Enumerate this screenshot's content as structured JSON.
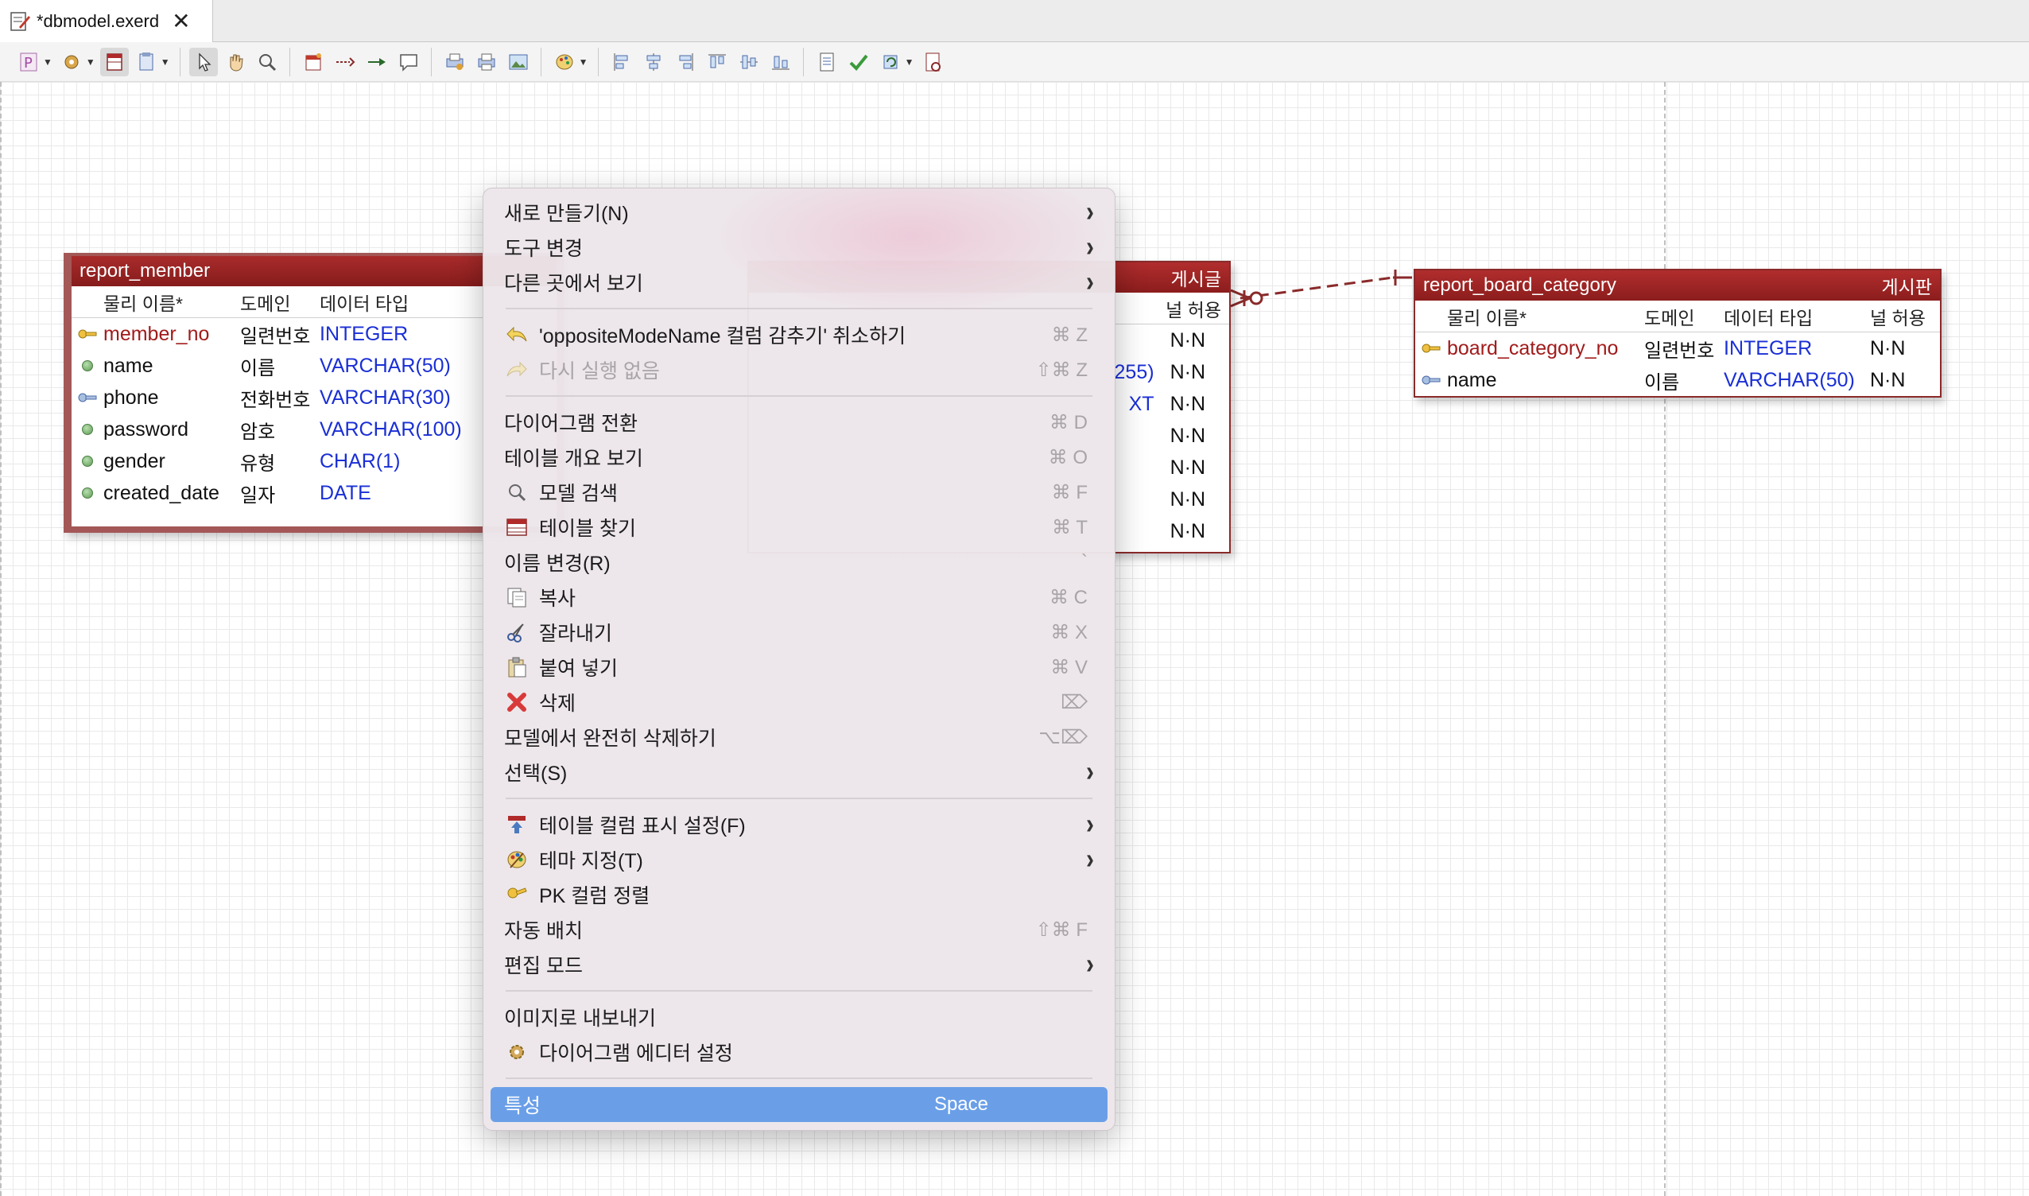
{
  "tab": {
    "title": "*dbmodel.exerd",
    "close": "✕"
  },
  "toolbar": {
    "groups": [
      [
        "schema-icon",
        "object-icon",
        "table-view-icon",
        "page-icon"
      ],
      [
        "select-icon",
        "hand-icon",
        "zoom-icon"
      ],
      [
        "table-icon",
        "relation-icon",
        "relation2-icon",
        "note-icon"
      ],
      [
        "print-setup-icon",
        "print-icon",
        "image-icon"
      ],
      [
        "theme-icon"
      ],
      [
        "align-left-icon",
        "align-center-icon",
        "align-right-icon",
        "align-top-icon",
        "align-middle-icon",
        "align-bottom-icon"
      ],
      [
        "doc-icon",
        "validate-icon",
        "sync-icon",
        "report-icon"
      ]
    ]
  },
  "tables": {
    "member": {
      "name": "report_member",
      "headers": [
        "물리 이름*",
        "도메인",
        "데이터 타입"
      ],
      "rows": [
        {
          "name": "member_no",
          "domain": "일련번호",
          "type": "INTEGER",
          "pk": true
        },
        {
          "name": "name",
          "domain": "이름",
          "type": "VARCHAR(50)"
        },
        {
          "name": "phone",
          "domain": "전화번호",
          "type": "VARCHAR(30)",
          "fk": true
        },
        {
          "name": "password",
          "domain": "암호",
          "type": "VARCHAR(100)"
        },
        {
          "name": "gender",
          "domain": "유형",
          "type": "CHAR(1)"
        },
        {
          "name": "created_date",
          "domain": "일자",
          "type": "DATE"
        }
      ]
    },
    "board": {
      "logical_name": "게시글",
      "null_header": "널 허용",
      "type_fragments": [
        "255)",
        "XT"
      ],
      "nulls": [
        "N·N",
        "N·N",
        "N·N",
        "N·N",
        "N·N",
        "N·N",
        "N·N"
      ]
    },
    "category": {
      "name": "report_board_category",
      "logical_name": "게시판",
      "headers": [
        "물리 이름*",
        "도메인",
        "데이터 타입",
        "널 허용"
      ],
      "rows": [
        {
          "name": "board_category_no",
          "domain": "일련번호",
          "type": "INTEGER",
          "nn": "N·N",
          "pk": true
        },
        {
          "name": "name",
          "domain": "이름",
          "type": "VARCHAR(50)",
          "nn": "N·N",
          "fk": true
        }
      ]
    }
  },
  "menu": {
    "items": {
      "new": "새로 만들기(N)",
      "change_tool": "도구 변경",
      "show_in": "다른 곳에서 보기",
      "undo": "'oppositeModeName 컬럼 감추기' 취소하기",
      "undo_sc": "⌘ Z",
      "redo": "다시 실행 없음",
      "redo_sc": "⇧⌘ Z",
      "switch_diagram": "다이어그램 전환",
      "switch_diagram_sc": "⌘ D",
      "table_overview": "테이블 개요 보기",
      "table_overview_sc": "⌘ O",
      "search_model": "모델 검색",
      "search_model_sc": "⌘ F",
      "find_table": "테이블 찾기",
      "find_table_sc": "⌘ T",
      "rename": "이름 변경(R)",
      "rename_sc": "`",
      "copy": "복사",
      "copy_sc": "⌘ C",
      "cut": "잘라내기",
      "cut_sc": "⌘ X",
      "paste": "붙여 넣기",
      "paste_sc": "⌘ V",
      "delete": "삭제",
      "delete_sc": "⌦",
      "delete_model": "모델에서 완전히 삭제하기",
      "delete_model_sc": "⌥⌦",
      "select": "선택(S)",
      "column_display": "테이블 컬럼 표시 설정(F)",
      "theme": "테마 지정(T)",
      "pk_sort": "PK 컬럼 정렬",
      "auto_layout": "자동 배치",
      "auto_layout_sc": "⇧⌘ F",
      "edit_mode": "편집 모드",
      "export_image": "이미지로 내보내기",
      "editor_settings": "다이어그램 에디터 설정",
      "properties": "특성",
      "properties_sc": "Space"
    }
  }
}
